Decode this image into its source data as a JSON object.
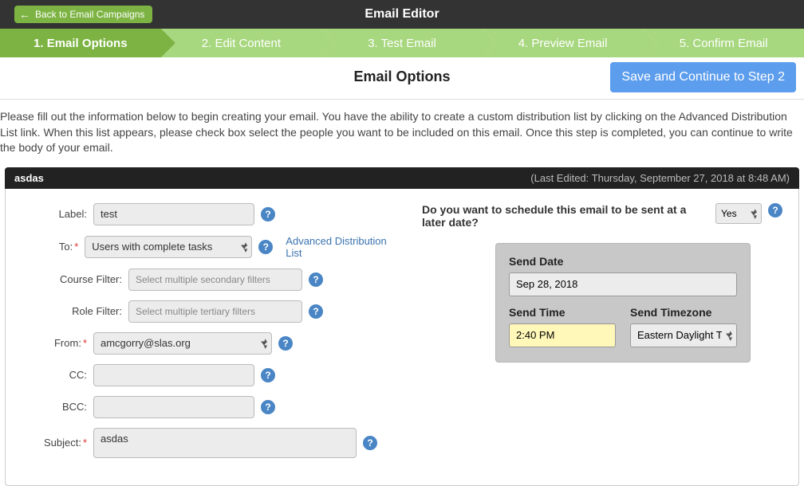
{
  "header": {
    "back_label": "Back to Email Campaigns",
    "title": "Email Editor"
  },
  "steps": [
    "1. Email Options",
    "2. Edit Content",
    "3. Test Email",
    "4. Preview Email",
    "5. Confirm Email"
  ],
  "section": {
    "title": "Email Options",
    "save_label": "Save and Continue to Step 2"
  },
  "intro": "Please fill out the information below to begin creating your email. You have the ability to create a custom distribution list by clicking on the Advanced Distribution List link. When this list appears, please check box select the people you want to be included on this email. Once this step is completed, you can continue to write the body of your email.",
  "panel": {
    "name": "asdas",
    "meta": "(Last Edited: Thursday, September 27, 2018 at 8:48 AM)"
  },
  "form": {
    "label_label": "Label:",
    "label_value": "test",
    "to_label": "To:",
    "to_value": "Users with complete tasks",
    "adv_link": "Advanced Distribution List",
    "course_filter_label": "Course Filter:",
    "course_filter_placeholder": "Select multiple secondary filters",
    "role_filter_label": "Role Filter:",
    "role_filter_placeholder": "Select multiple tertiary filters",
    "from_label": "From:",
    "from_value": "amcgorry@slas.org",
    "cc_label": "CC:",
    "cc_value": "",
    "bcc_label": "BCC:",
    "bcc_value": "",
    "subject_label": "Subject:",
    "subject_value": "asdas"
  },
  "schedule": {
    "question": "Do you want to schedule this email to be sent at a later date?",
    "answer": "Yes",
    "send_date_label": "Send Date",
    "send_date_value": "Sep 28, 2018",
    "send_time_label": "Send Time",
    "send_time_value": "2:40 PM",
    "send_tz_label": "Send Timezone",
    "send_tz_value": "Eastern Daylight Ti"
  }
}
